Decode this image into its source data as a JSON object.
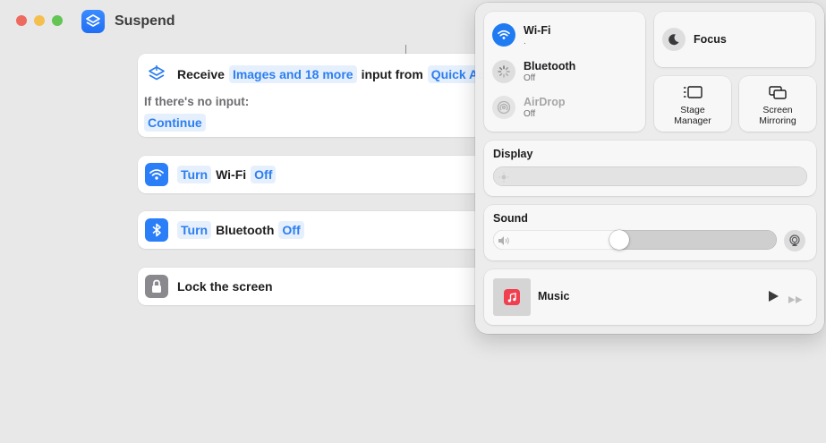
{
  "window": {
    "title": "Suspend"
  },
  "actions": {
    "receive": {
      "label": "Receive",
      "types": "Images and 18 more",
      "input_from": "input from",
      "source": "Quick Act",
      "no_input_label": "If there's no input:",
      "no_input_action": "Continue"
    },
    "wifi": {
      "verb": "Turn",
      "object": "Wi-Fi",
      "state": "Off"
    },
    "bluetooth": {
      "verb": "Turn",
      "object": "Bluetooth",
      "state": "Off"
    },
    "lock": {
      "label": "Lock the screen"
    }
  },
  "control_center": {
    "wifi": {
      "label": "Wi-Fi",
      "status": "."
    },
    "bluetooth": {
      "label": "Bluetooth",
      "status": "Off"
    },
    "airdrop": {
      "label": "AirDrop",
      "status": "Off"
    },
    "focus": {
      "label": "Focus"
    },
    "stage_manager": {
      "label_line1": "Stage",
      "label_line2": "Manager"
    },
    "screen_mirroring": {
      "label_line1": "Screen",
      "label_line2": "Mirroring"
    },
    "display": {
      "label": "Display",
      "level": 0.0
    },
    "sound": {
      "label": "Sound",
      "level": 0.44
    },
    "music": {
      "label": "Music"
    }
  },
  "colors": {
    "accent": "#1f7bf2",
    "app_icon": "#2a7ef8",
    "music_red": "#f0404f"
  },
  "icons": [
    "shortcuts-app-icon",
    "receive-icon",
    "wifi-icon",
    "bluetooth-icon",
    "lock-icon",
    "moon-icon",
    "stage-manager-icon",
    "screen-mirroring-icon",
    "sun-icon",
    "speaker-icon",
    "airplay-icon",
    "music-note-icon",
    "play-icon",
    "forward-icon"
  ]
}
